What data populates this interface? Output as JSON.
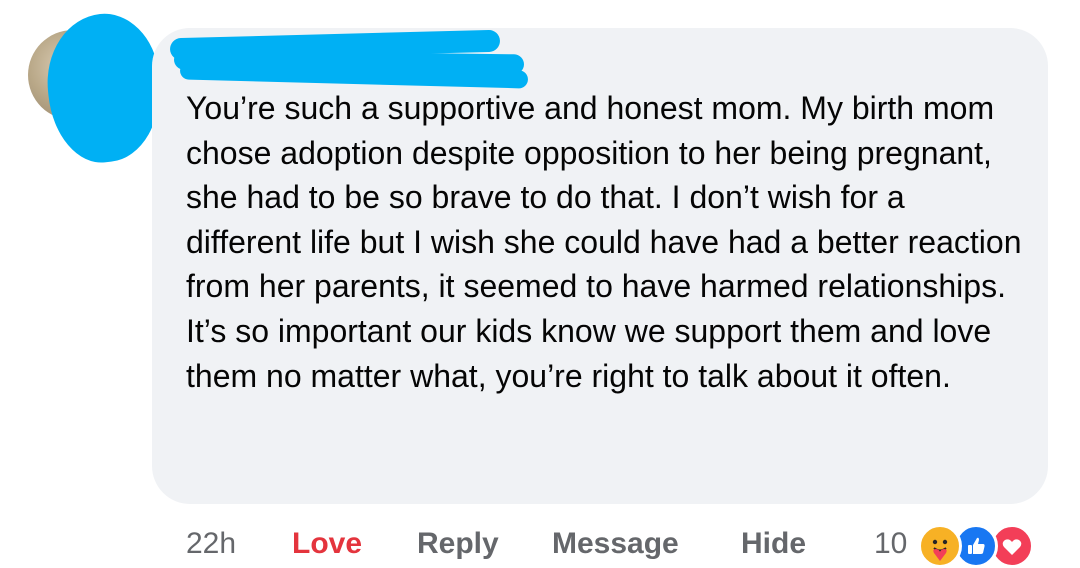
{
  "comment": {
    "text": "You’re such a supportive and honest mom. My birth mom chose adoption despite opposition to her being pregnant, she had to be so brave to do that. I don’t wish for a different life but I wish she could have had a better reaction from her parents, it seemed to have harmed relationships. It’s so important our kids know we support them and love them no matter what, you’re right to talk about it often."
  },
  "actions": {
    "timestamp": "22h",
    "love_label": "Love",
    "reply_label": "Reply",
    "message_label": "Message",
    "hide_label": "Hide"
  },
  "reactions": {
    "count": "10",
    "icons": [
      "care-icon",
      "like-icon",
      "love-icon"
    ]
  },
  "colors": {
    "bubble_background": "#f0f2f5",
    "love_accent": "#e4343d",
    "redaction": "#00b0f4",
    "secondary_text": "#65676b"
  }
}
